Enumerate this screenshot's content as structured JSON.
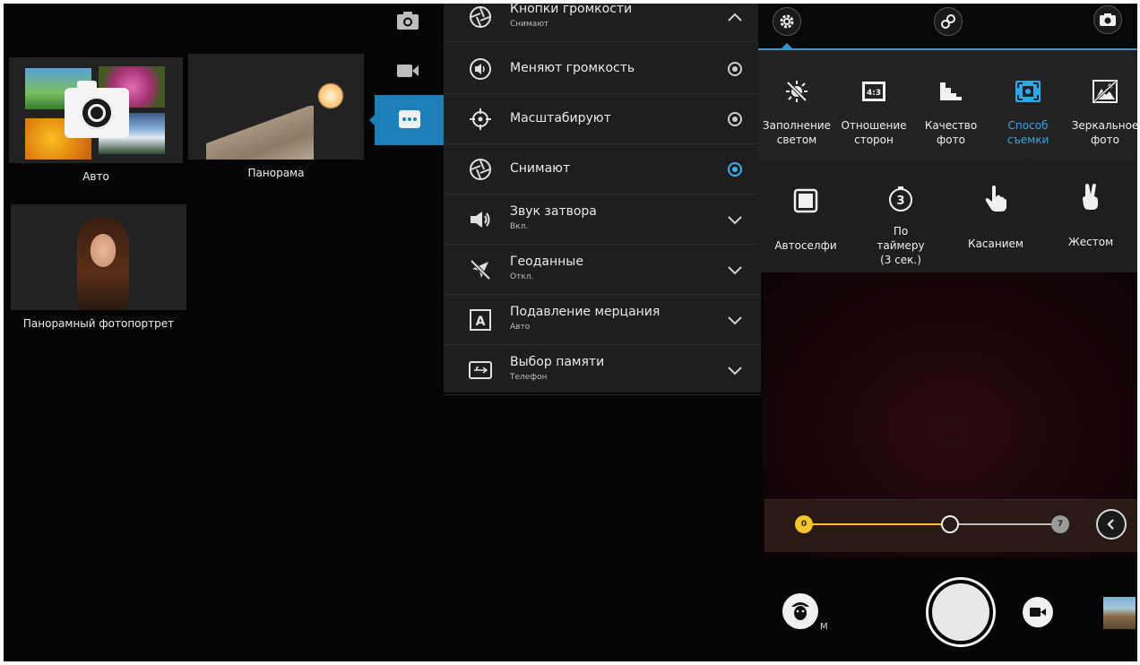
{
  "modes": [
    {
      "label": "Авто"
    },
    {
      "label": "Панорама"
    },
    {
      "label": "Панорамный фотопортрет"
    }
  ],
  "settings": [
    {
      "title": "Кнопки громкости",
      "sub": "Снимают",
      "control": "collapse"
    },
    {
      "title": "Меняют громкость",
      "sub": "",
      "control": "radio"
    },
    {
      "title": "Масштабируют",
      "sub": "",
      "control": "radio"
    },
    {
      "title": "Снимают",
      "sub": "",
      "control": "radio-selected"
    },
    {
      "title": "Звук затвора",
      "sub": "Вкл.",
      "control": "expand"
    },
    {
      "title": "Геоданные",
      "sub": "Откл.",
      "control": "expand"
    },
    {
      "title": "Подавление мерцания",
      "sub": "Авто",
      "control": "expand"
    },
    {
      "title": "Выбор памяти",
      "sub": "Телефон",
      "control": "expand"
    }
  ],
  "camera_options": [
    {
      "label": "Заполнение светом",
      "icon": "fill-light-icon"
    },
    {
      "label": "Отношение сторон",
      "icon": "aspect-ratio-icon",
      "badge": "4:3"
    },
    {
      "label": "Качество фото",
      "icon": "photo-quality-icon"
    },
    {
      "label": "Способ съемки",
      "icon": "shooting-method-icon",
      "active": true
    },
    {
      "label": "Зеркальное фото",
      "icon": "mirror-photo-icon"
    }
  ],
  "shooting_methods": [
    {
      "label": "Автоселфи",
      "icon": "auto-selfie-icon"
    },
    {
      "label": "По таймеру (3 сек.)",
      "icon": "timer-icon",
      "badge": "3"
    },
    {
      "label": "Касанием",
      "icon": "touch-icon"
    },
    {
      "label": "Жестом",
      "icon": "gesture-icon"
    }
  ],
  "zoom": {
    "min": "0",
    "max": "7",
    "value_fraction": 0.57
  },
  "beauty": {
    "badge": "M"
  },
  "colors": {
    "accent_blue": "#2a9ad8",
    "zoom_yellow": "#f2c530",
    "panel": "#1e1e1e"
  }
}
